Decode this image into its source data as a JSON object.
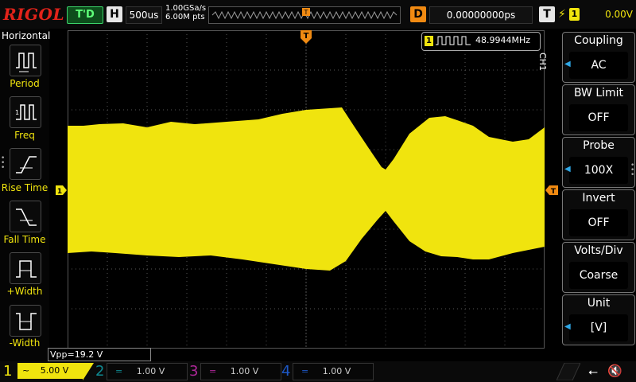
{
  "top": {
    "logo": "RIGOL",
    "run_state": "T'D",
    "horizontal_letter": "H",
    "timebase": "500us",
    "sample_rate": "1.00GSa/s",
    "memory_depth": "6.00M pts",
    "delay_letter": "D",
    "delay_value": "0.00000000ps",
    "trigger_letter": "T",
    "trigger_icon": "rising-edge-icon",
    "trigger_source": "1",
    "trigger_level": "0.00V"
  },
  "left_menu": {
    "title": "Horizontal",
    "items": [
      {
        "label": "Period",
        "icon": "period-icon"
      },
      {
        "label": "Freq",
        "icon": "frequency-icon"
      },
      {
        "label": "Rise Time",
        "icon": "rise-time-icon"
      },
      {
        "label": "Fall Time",
        "icon": "fall-time-icon"
      },
      {
        "label": "+Width",
        "icon": "positive-width-icon"
      },
      {
        "label": "-Width",
        "icon": "negative-width-icon"
      }
    ]
  },
  "measurement": {
    "channel": "1",
    "frequency": "48.9944MHz",
    "vpp": "Vpp=19.2 V"
  },
  "channel_marker": "1",
  "trigger_marker": "T",
  "right_menu": {
    "channel_label": "CH1",
    "items": [
      {
        "title": "Coupling",
        "value": "AC",
        "arrow": true
      },
      {
        "title": "BW Limit",
        "value": "OFF",
        "arrow": false
      },
      {
        "title": "Probe",
        "value": "100X",
        "arrow": true
      },
      {
        "title": "Invert",
        "value": "OFF",
        "arrow": false
      },
      {
        "title": "Volts/Div",
        "value": "Coarse",
        "arrow": false
      },
      {
        "title": "Unit",
        "value": "[V]",
        "arrow": true
      }
    ]
  },
  "bottom": {
    "channels": [
      {
        "number": "1",
        "coupling_icon": "~",
        "scale": "5.00 V",
        "active": true,
        "color": "#f0e40e"
      },
      {
        "number": "2",
        "coupling_icon": "=",
        "scale": "1.00 V",
        "active": false,
        "color": "#0f8a92"
      },
      {
        "number": "3",
        "coupling_icon": "=",
        "scale": "1.00 V",
        "active": false,
        "color": "#b0279a"
      },
      {
        "number": "4",
        "coupling_icon": "=",
        "scale": "1.00 V",
        "active": false,
        "color": "#1d58c7"
      }
    ]
  },
  "colors": {
    "trace": "#f0e40e",
    "logo": "#e2231a",
    "trigger_marker": "#f08a12",
    "menu_arrow": "#2fa7e6"
  }
}
